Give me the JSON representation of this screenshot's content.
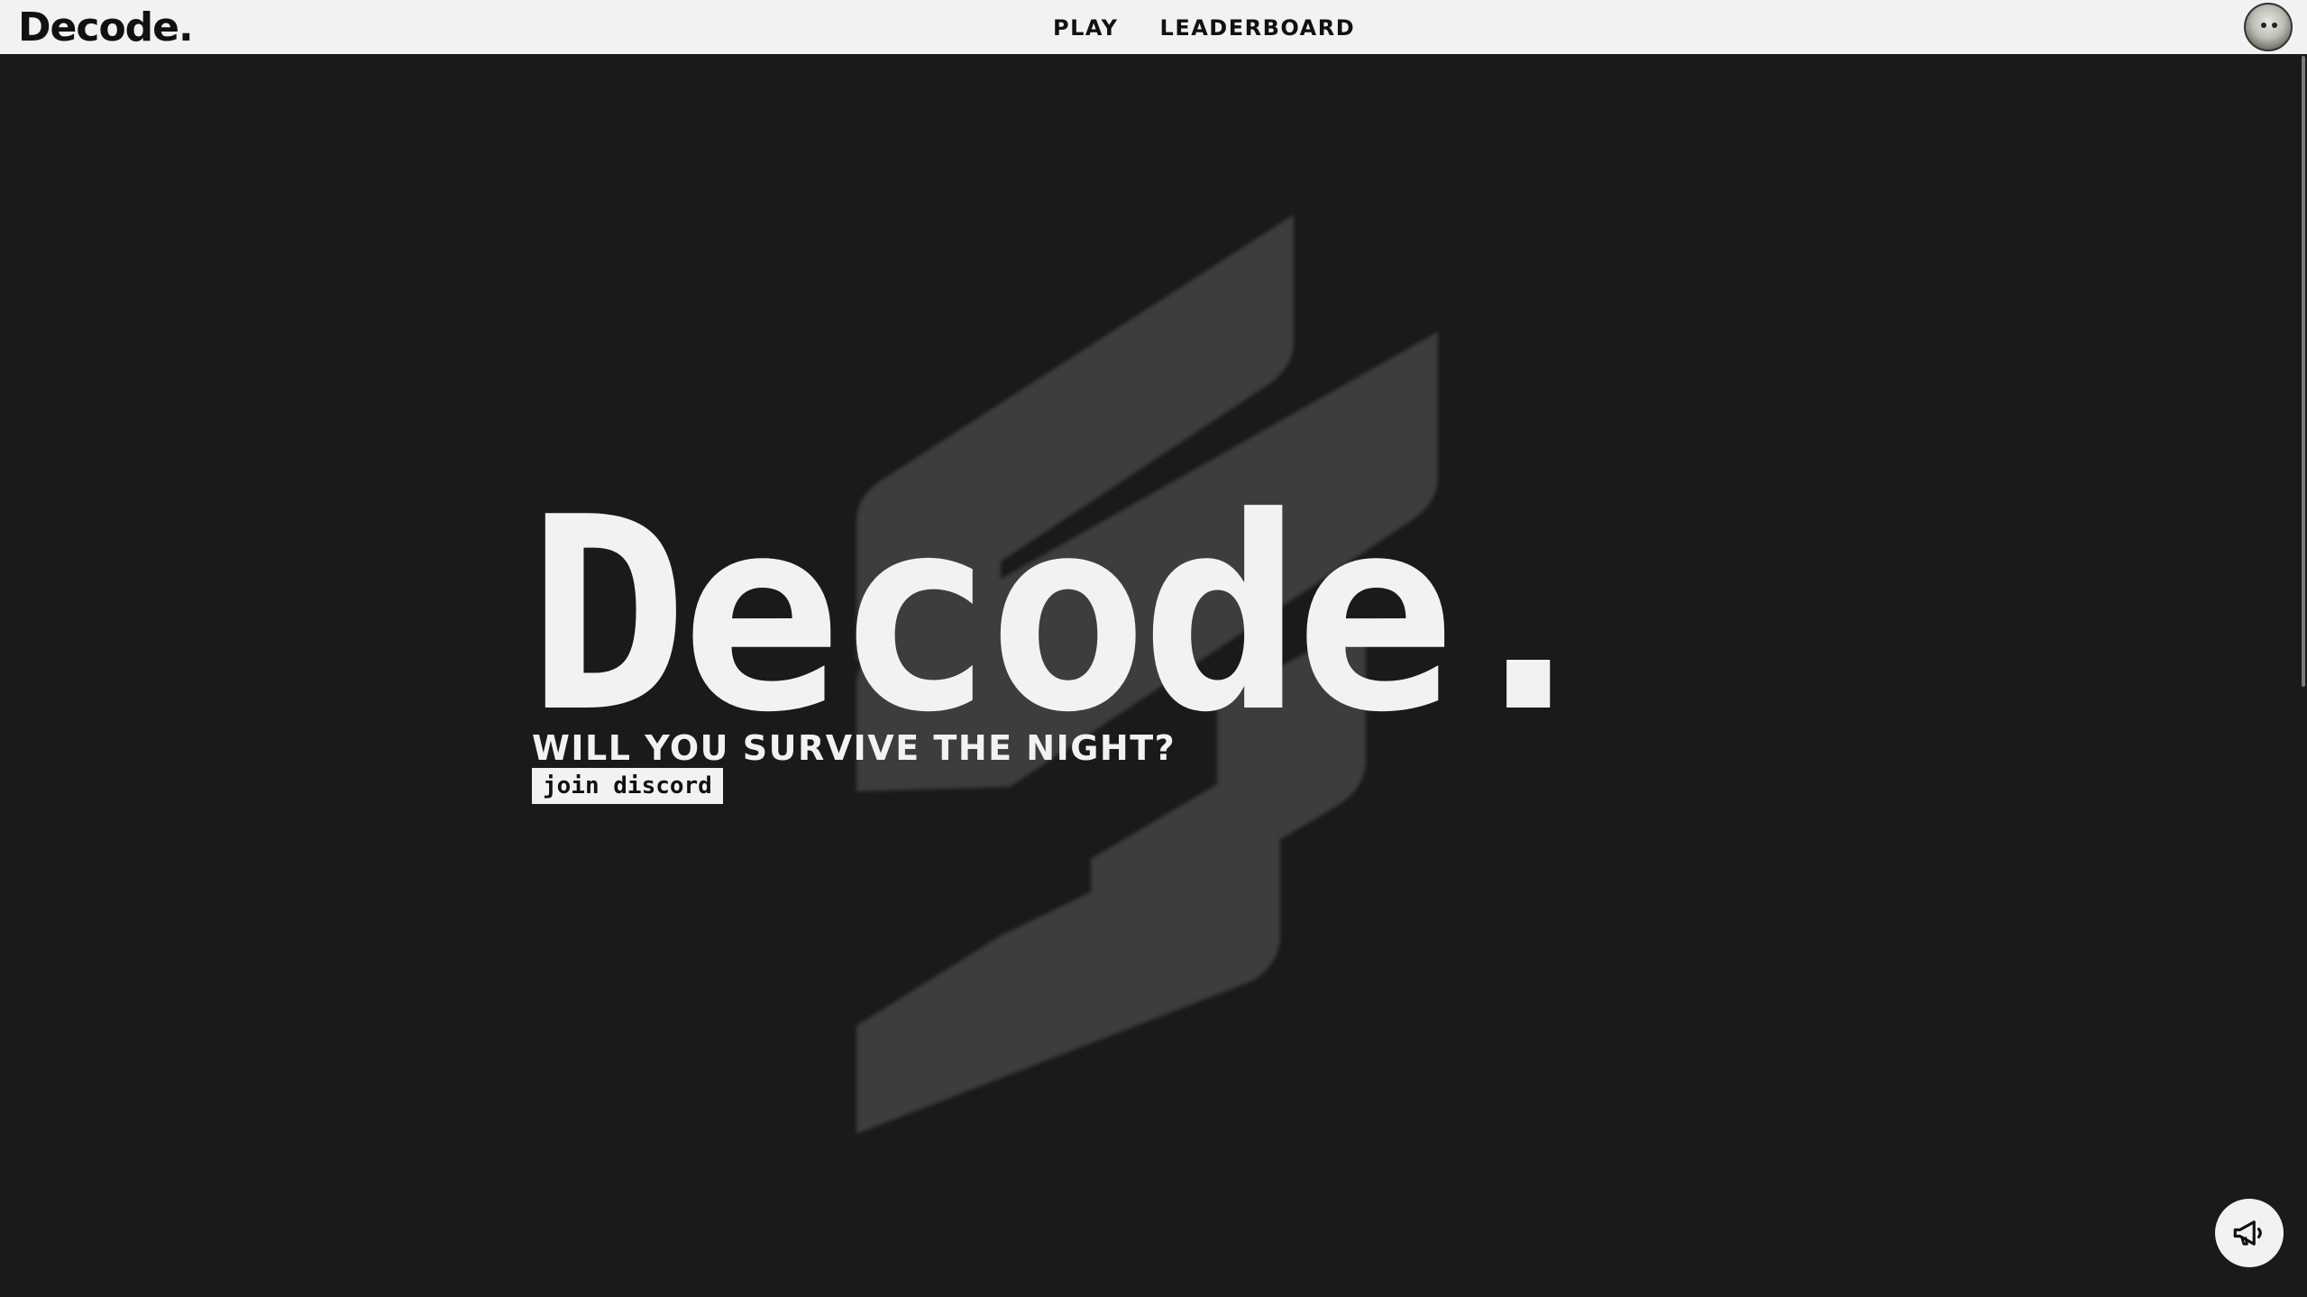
{
  "navbar": {
    "brand": "Decode.",
    "links": [
      {
        "label": "PLAY"
      },
      {
        "label": "LEADERBOARD"
      }
    ]
  },
  "hero": {
    "title": "Decode.",
    "tagline": "WILL YOU SURVIVE THE NIGHT?",
    "discord_label": "join discord"
  },
  "icons": {
    "avatar": "user-avatar",
    "announce": "megaphone-icon",
    "background_logo": "decode-logo-mark"
  },
  "colors": {
    "background": "#1a1a1a",
    "navbar": "#f2f2f2",
    "text_light": "#f2f2f2",
    "text_dark": "#111111",
    "logo_mark": "#3d3d3d"
  }
}
